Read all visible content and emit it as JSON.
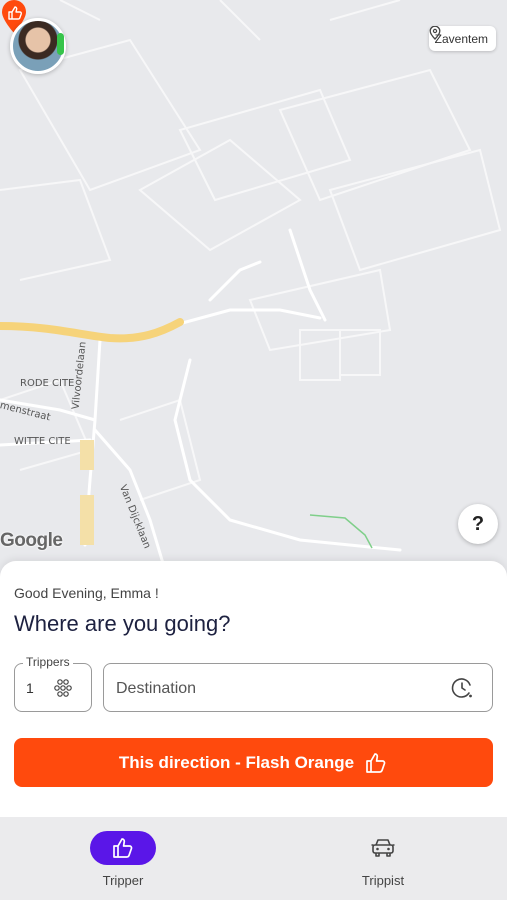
{
  "map": {
    "labels": {
      "rode_cite": "RODE CITE",
      "street_menstraat": "menstraat",
      "witte_cite": "WITTE CITE",
      "vilvoordelaan": "Vilvoordelaan",
      "van_dijcklaan": "Van Dijcklaan"
    },
    "attribution": "Google",
    "location_chip": "Zaventem",
    "help_label": "?"
  },
  "sheet": {
    "greeting": "Good Evening, Emma !",
    "headline": "Where are you going?",
    "trippers": {
      "label": "Trippers",
      "value": "1"
    },
    "destination": {
      "placeholder": "Destination",
      "value": ""
    },
    "cta_label": "This direction - Flash Orange"
  },
  "nav": {
    "items": [
      {
        "label": "Tripper",
        "icon": "thumbs-up-icon",
        "active": true
      },
      {
        "label": "Trippist",
        "icon": "car-icon",
        "active": false
      }
    ]
  },
  "colors": {
    "accent": "#ff4a0d",
    "nav_active": "#5a16e8",
    "headline": "#1d2140",
    "online": "#36c44a"
  }
}
